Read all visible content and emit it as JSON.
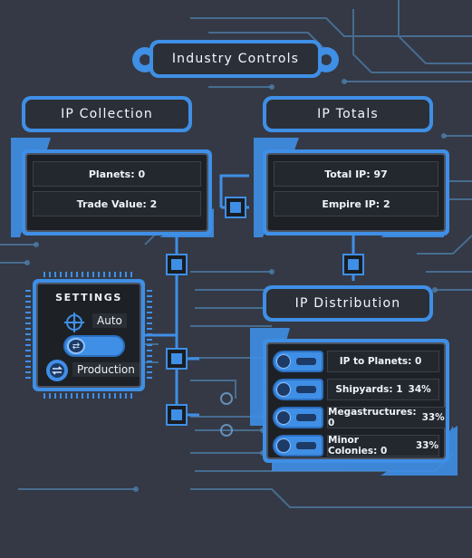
{
  "header": {
    "title": "Industry Controls"
  },
  "ip_collection": {
    "title": "IP Collection",
    "planets": "Planets: 0",
    "trade_value": "Trade Value: 2"
  },
  "ip_totals": {
    "title": "IP Totals",
    "total_ip": "Total IP: 97",
    "empire_ip": "Empire IP: 2"
  },
  "settings": {
    "title": "SETTINGS",
    "auto_label": "Auto",
    "production_label": "Production"
  },
  "ip_distribution": {
    "title": "IP Distribution",
    "rows": [
      {
        "label": "IP to Planets: 0",
        "percent": ""
      },
      {
        "label": "Shipyards: 1",
        "percent": "34%"
      },
      {
        "label": "Megastructures: 0",
        "percent": "33%"
      },
      {
        "label": "Minor Colonies: 0",
        "percent": "33%"
      }
    ]
  },
  "colors": {
    "accent": "#3f8fe6",
    "background": "#343945",
    "screen": "#1d2126"
  },
  "icons": [
    "gear-icon",
    "crosshair-icon",
    "cycle-icon",
    "connector-chip-icon"
  ]
}
